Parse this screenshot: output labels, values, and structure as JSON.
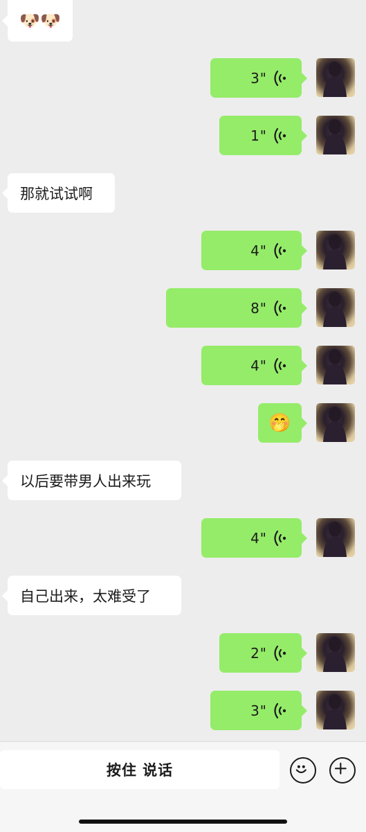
{
  "messages": [
    {
      "side": "left",
      "type": "sticker",
      "stickers": [
        "🐶",
        "🐶"
      ]
    },
    {
      "side": "right",
      "type": "voice",
      "duration": "3\""
    },
    {
      "side": "right",
      "type": "voice",
      "duration": "1\""
    },
    {
      "side": "left",
      "type": "text",
      "text": "那就试试啊"
    },
    {
      "side": "right",
      "type": "voice",
      "duration": "4\""
    },
    {
      "side": "right",
      "type": "voice",
      "duration": "8\""
    },
    {
      "side": "right",
      "type": "voice",
      "duration": "4\""
    },
    {
      "side": "right",
      "type": "sticker",
      "sticker": "🤭"
    },
    {
      "side": "left",
      "type": "text",
      "text": "以后要带男人出来玩"
    },
    {
      "side": "right",
      "type": "voice",
      "duration": "4\""
    },
    {
      "side": "left",
      "type": "text",
      "text": "自己出来，太难受了"
    },
    {
      "side": "right",
      "type": "voice",
      "duration": "2\""
    },
    {
      "side": "right",
      "type": "voice",
      "duration": "3\""
    }
  ],
  "input_bar": {
    "hold_to_talk_label": "按住 说话",
    "emoji_icon": "smiley-icon",
    "more_icon": "plus-icon"
  },
  "colors": {
    "background": "#ededed",
    "outgoing_bubble": "#95ec69",
    "incoming_bubble": "#ffffff"
  }
}
